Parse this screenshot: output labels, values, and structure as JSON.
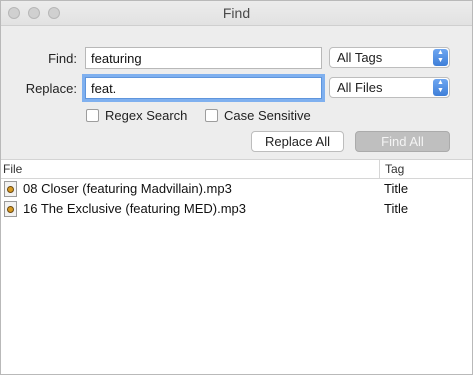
{
  "window": {
    "title": "Find"
  },
  "form": {
    "find_label": "Find:",
    "find_value": "featuring",
    "replace_label": "Replace:",
    "replace_value": "feat.",
    "tags_select": "All Tags",
    "files_select": "All Files",
    "regex_label": "Regex Search",
    "regex_checked": false,
    "case_label": "Case Sensitive",
    "case_checked": false,
    "replace_all_button": "Replace All",
    "find_all_button": "Find All"
  },
  "results": {
    "columns": [
      "File",
      "Tag"
    ],
    "rows": [
      {
        "file": "08 Closer (featuring Madvillain).mp3",
        "tag": "Title"
      },
      {
        "file": "16 The Exclusive (featuring MED).mp3",
        "tag": "Title"
      }
    ]
  }
}
